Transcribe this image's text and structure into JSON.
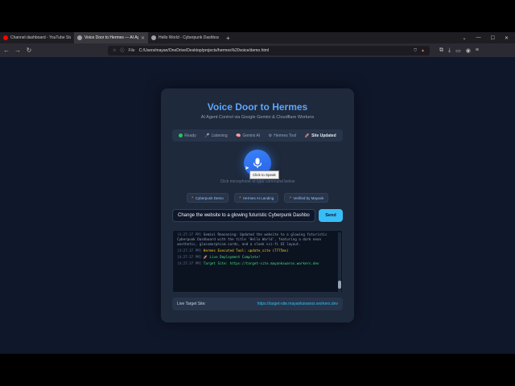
{
  "browser": {
    "tabs": [
      {
        "title": "Channel dashboard - YouTube Studio",
        "active": false,
        "favicon_color": "#ff0000"
      },
      {
        "title": "Voice Door to Hermes — AI Age",
        "active": true,
        "favicon_color": "#9ca3af"
      },
      {
        "title": "Hello World - Cyberpunk Dashboard",
        "active": false,
        "favicon_color": "#9ca3af"
      }
    ],
    "new_tab": "+",
    "url_label": "File",
    "url": "C:/Users/mayan/OneDrive/Desktop/projects/hermes%20voice/demo.html"
  },
  "header": {
    "title": "Voice Door to Hermes",
    "subtitle": "AI Agent Control via Google Gemini & Cloudflare Workers"
  },
  "status_steps": [
    {
      "label": "Ready",
      "icon": "green-dot"
    },
    {
      "label": "Listening",
      "icon": "microphone-icon"
    },
    {
      "label": "Gemini AI",
      "icon": "brain-icon"
    },
    {
      "label": "Hermes Tool",
      "icon": "gear-icon"
    },
    {
      "label": "Site Updated",
      "icon": "rocket-icon",
      "active": true
    }
  ],
  "mic": {
    "tooltip": "Click to Speak",
    "hint": "Click microphone or type command below"
  },
  "chips": [
    {
      "label": "Cyberpunk Demo"
    },
    {
      "label": "Hermes AI Landing"
    },
    {
      "label": "Verified by Mayank"
    }
  ],
  "command": {
    "value": "Change the website to a glowing futuristic Cyberpunk Dashbo",
    "send_label": "Send"
  },
  "log": [
    {
      "time": "[4:27:37 PM]",
      "text": "Gemini Reasoning: Updated the website to a glowing futuristic Cyberpunk Dashboard with the title 'Hello World', featuring a dark neon aesthetic, glassmorphism cards, and a sleek sci-fi UI layout.",
      "color": "gray"
    },
    {
      "time": "[4:27:37 PM]",
      "text": "Hermes Executed Tool: update_site (7775ms)",
      "color": "yellow"
    },
    {
      "time": "[4:27:37 PM]",
      "text": "🚀 Live Deployment Complete!",
      "color": "green"
    },
    {
      "time": "[4:27:37 PM]",
      "text": "Target Site: https://target-site.mayankswaros.workers.dev",
      "color": "green"
    }
  ],
  "target": {
    "label": "Live Target Site:",
    "url": "https://target-site.mayankswaros.workers.dev"
  },
  "colors": {
    "page_bg": "#0f172a",
    "card_bg": "#1e293b",
    "accent": "#60a5fa",
    "send": "#38bdf8"
  }
}
